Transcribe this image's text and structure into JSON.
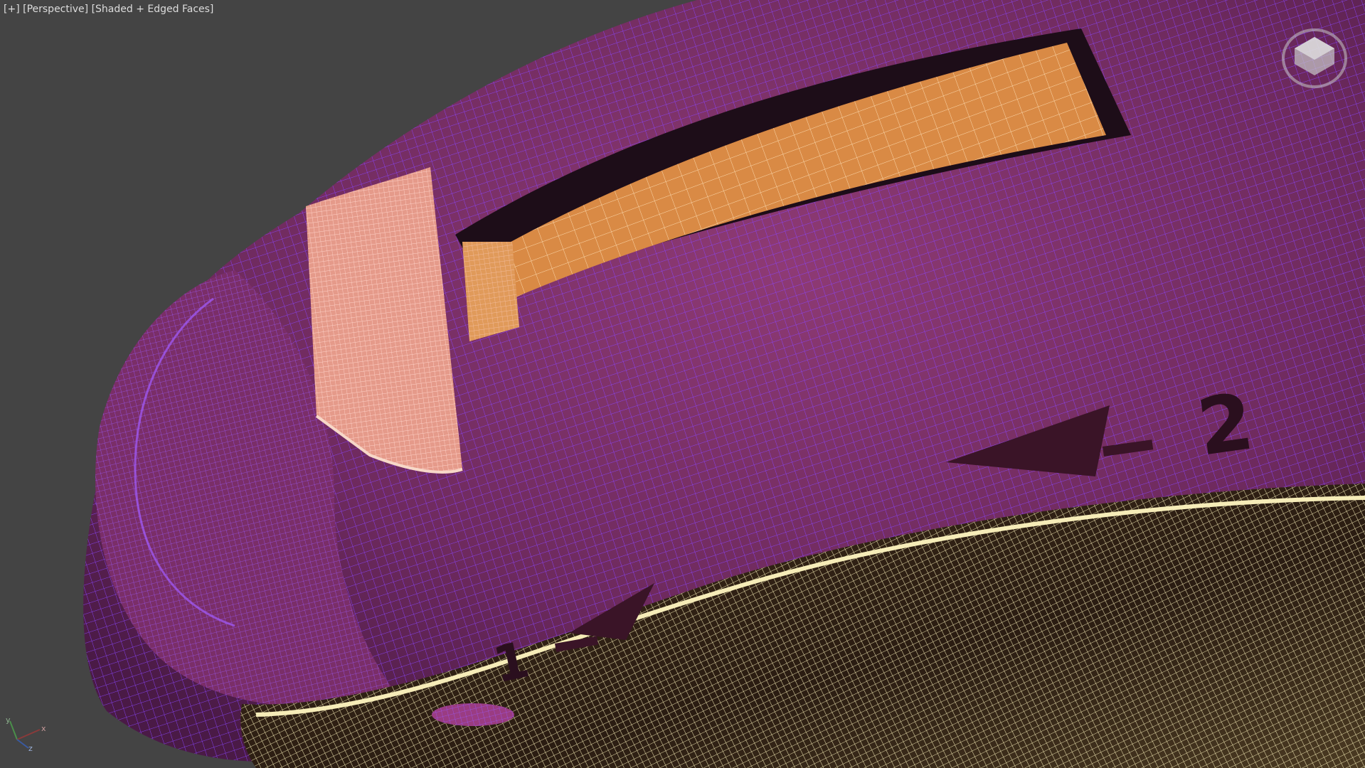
{
  "viewport": {
    "labels": [
      "[+]",
      "[Perspective]",
      "[Shaded + Edged Faces]"
    ],
    "embossed_numbers": [
      "1",
      "2"
    ],
    "viewcube_icon": "home-viewcube-icon",
    "axis_labels": [
      "x",
      "y",
      "z"
    ],
    "colors": {
      "background": "#444444",
      "surface": "#7d2f6a",
      "wire": "#7b3bff",
      "orange_part": "#d98a45",
      "pink_part": "#e59a8a",
      "cream_part": "#efe2a8"
    }
  }
}
